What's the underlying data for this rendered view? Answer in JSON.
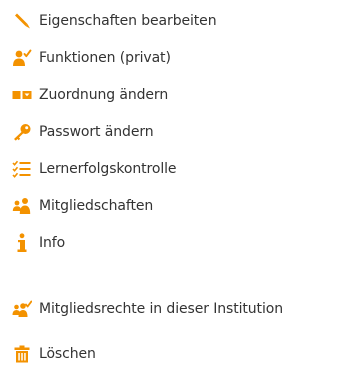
{
  "accent_color": "#f39200",
  "menu": {
    "items": [
      {
        "label": "Eigenschaften bearbeiten",
        "icon": "pencil-icon"
      },
      {
        "label": "Funktionen (privat)",
        "icon": "user-check-icon"
      },
      {
        "label": "Zuordnung ändern",
        "icon": "assign-icon"
      },
      {
        "label": "Passwort ändern",
        "icon": "key-icon"
      },
      {
        "label": "Lernerfolgskontrolle",
        "icon": "checklist-icon"
      },
      {
        "label": "Mitgliedschaften",
        "icon": "group-icon"
      },
      {
        "label": "Info",
        "icon": "info-icon"
      }
    ],
    "institution_rights": {
      "label": "Mitgliedsrechte in dieser Institution",
      "icon": "group-check-icon"
    },
    "delete": {
      "label": "Löschen",
      "icon": "trash-icon"
    }
  }
}
